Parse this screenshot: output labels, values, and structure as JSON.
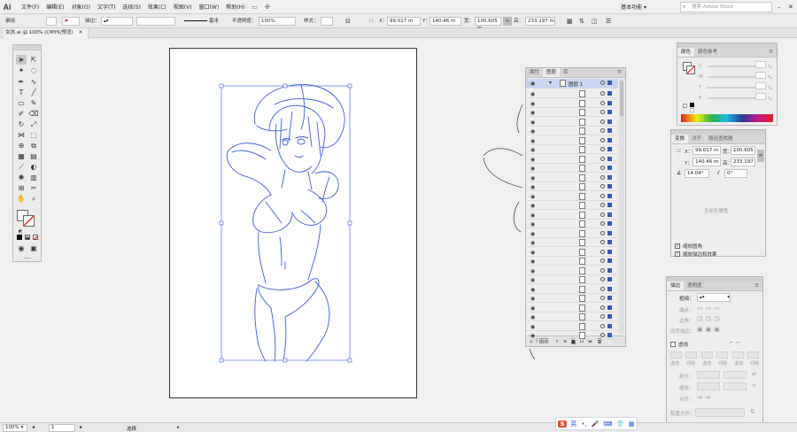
{
  "app": {
    "logo": "Ai"
  },
  "menu": [
    "文件(F)",
    "编辑(E)",
    "对象(O)",
    "文字(T)",
    "选择(S)",
    "效果(C)",
    "视图(V)",
    "窗口(W)",
    "帮助(H)"
  ],
  "workspace": "基本功能",
  "stock_search": {
    "placeholder": "搜索 Adobe Stock"
  },
  "control": {
    "mode_label": "编组",
    "stroke_label": "描边：",
    "brush_label": "基本",
    "opacity_label": "不透明度：",
    "opacity_value": "100%",
    "style_label": "样式：",
    "x_label": "X：",
    "x_value": "99.017 m",
    "y_label": "Y：",
    "y_value": "140.46 m",
    "w_label": "宽：",
    "w_value": "100.605 m",
    "h_label": "高：",
    "h_value": "233.197 m"
  },
  "document_tab": "女孩.ai @ 100% (CMYK/预览)",
  "layers": {
    "tabs": [
      "属性",
      "图层",
      "库"
    ],
    "layer_name": "图层 1",
    "footer": "1 个图层"
  },
  "color": {
    "tabs": [
      "颜色",
      "颜色参考"
    ],
    "channels": [
      "C",
      "M",
      "Y",
      "K"
    ],
    "unit": "%"
  },
  "transform": {
    "tabs": [
      "变换",
      "对齐",
      "路径查找器"
    ],
    "x_label": "X：",
    "x_value": "99.017 m",
    "y_label": "Y：",
    "y_value": "140.46 m",
    "w_label": "宽：",
    "w_value": "100.605",
    "h_label": "高：",
    "h_value": "233.197",
    "angle_value": "14.04°",
    "shear_value": "0°",
    "empty_msg": "无矩形属性",
    "scale_corners": "缩放圆角",
    "scale_strokes": "缩放描边和效果"
  },
  "stroke": {
    "tabs": [
      "描边",
      "透明度"
    ],
    "weight_label": "粗细：",
    "cap_label": "端点：",
    "corner_label": "边角：",
    "align_label": "对齐描边：",
    "dashed_label": "虚线",
    "dash_labels": [
      "虚线",
      "间隙",
      "虚线",
      "间隙",
      "虚线",
      "间隙"
    ],
    "arrow_label": "箭头：",
    "scale_label": "缩放：",
    "align2_label": "对齐：",
    "profile_label": "配置文件："
  },
  "status": {
    "zoom": "100%",
    "artboard_num": "1",
    "selection_label": "选择"
  },
  "ime": {
    "lang": "英"
  },
  "colors": {
    "selection": "#3b5bd6",
    "accent": "#3c5aa8"
  }
}
